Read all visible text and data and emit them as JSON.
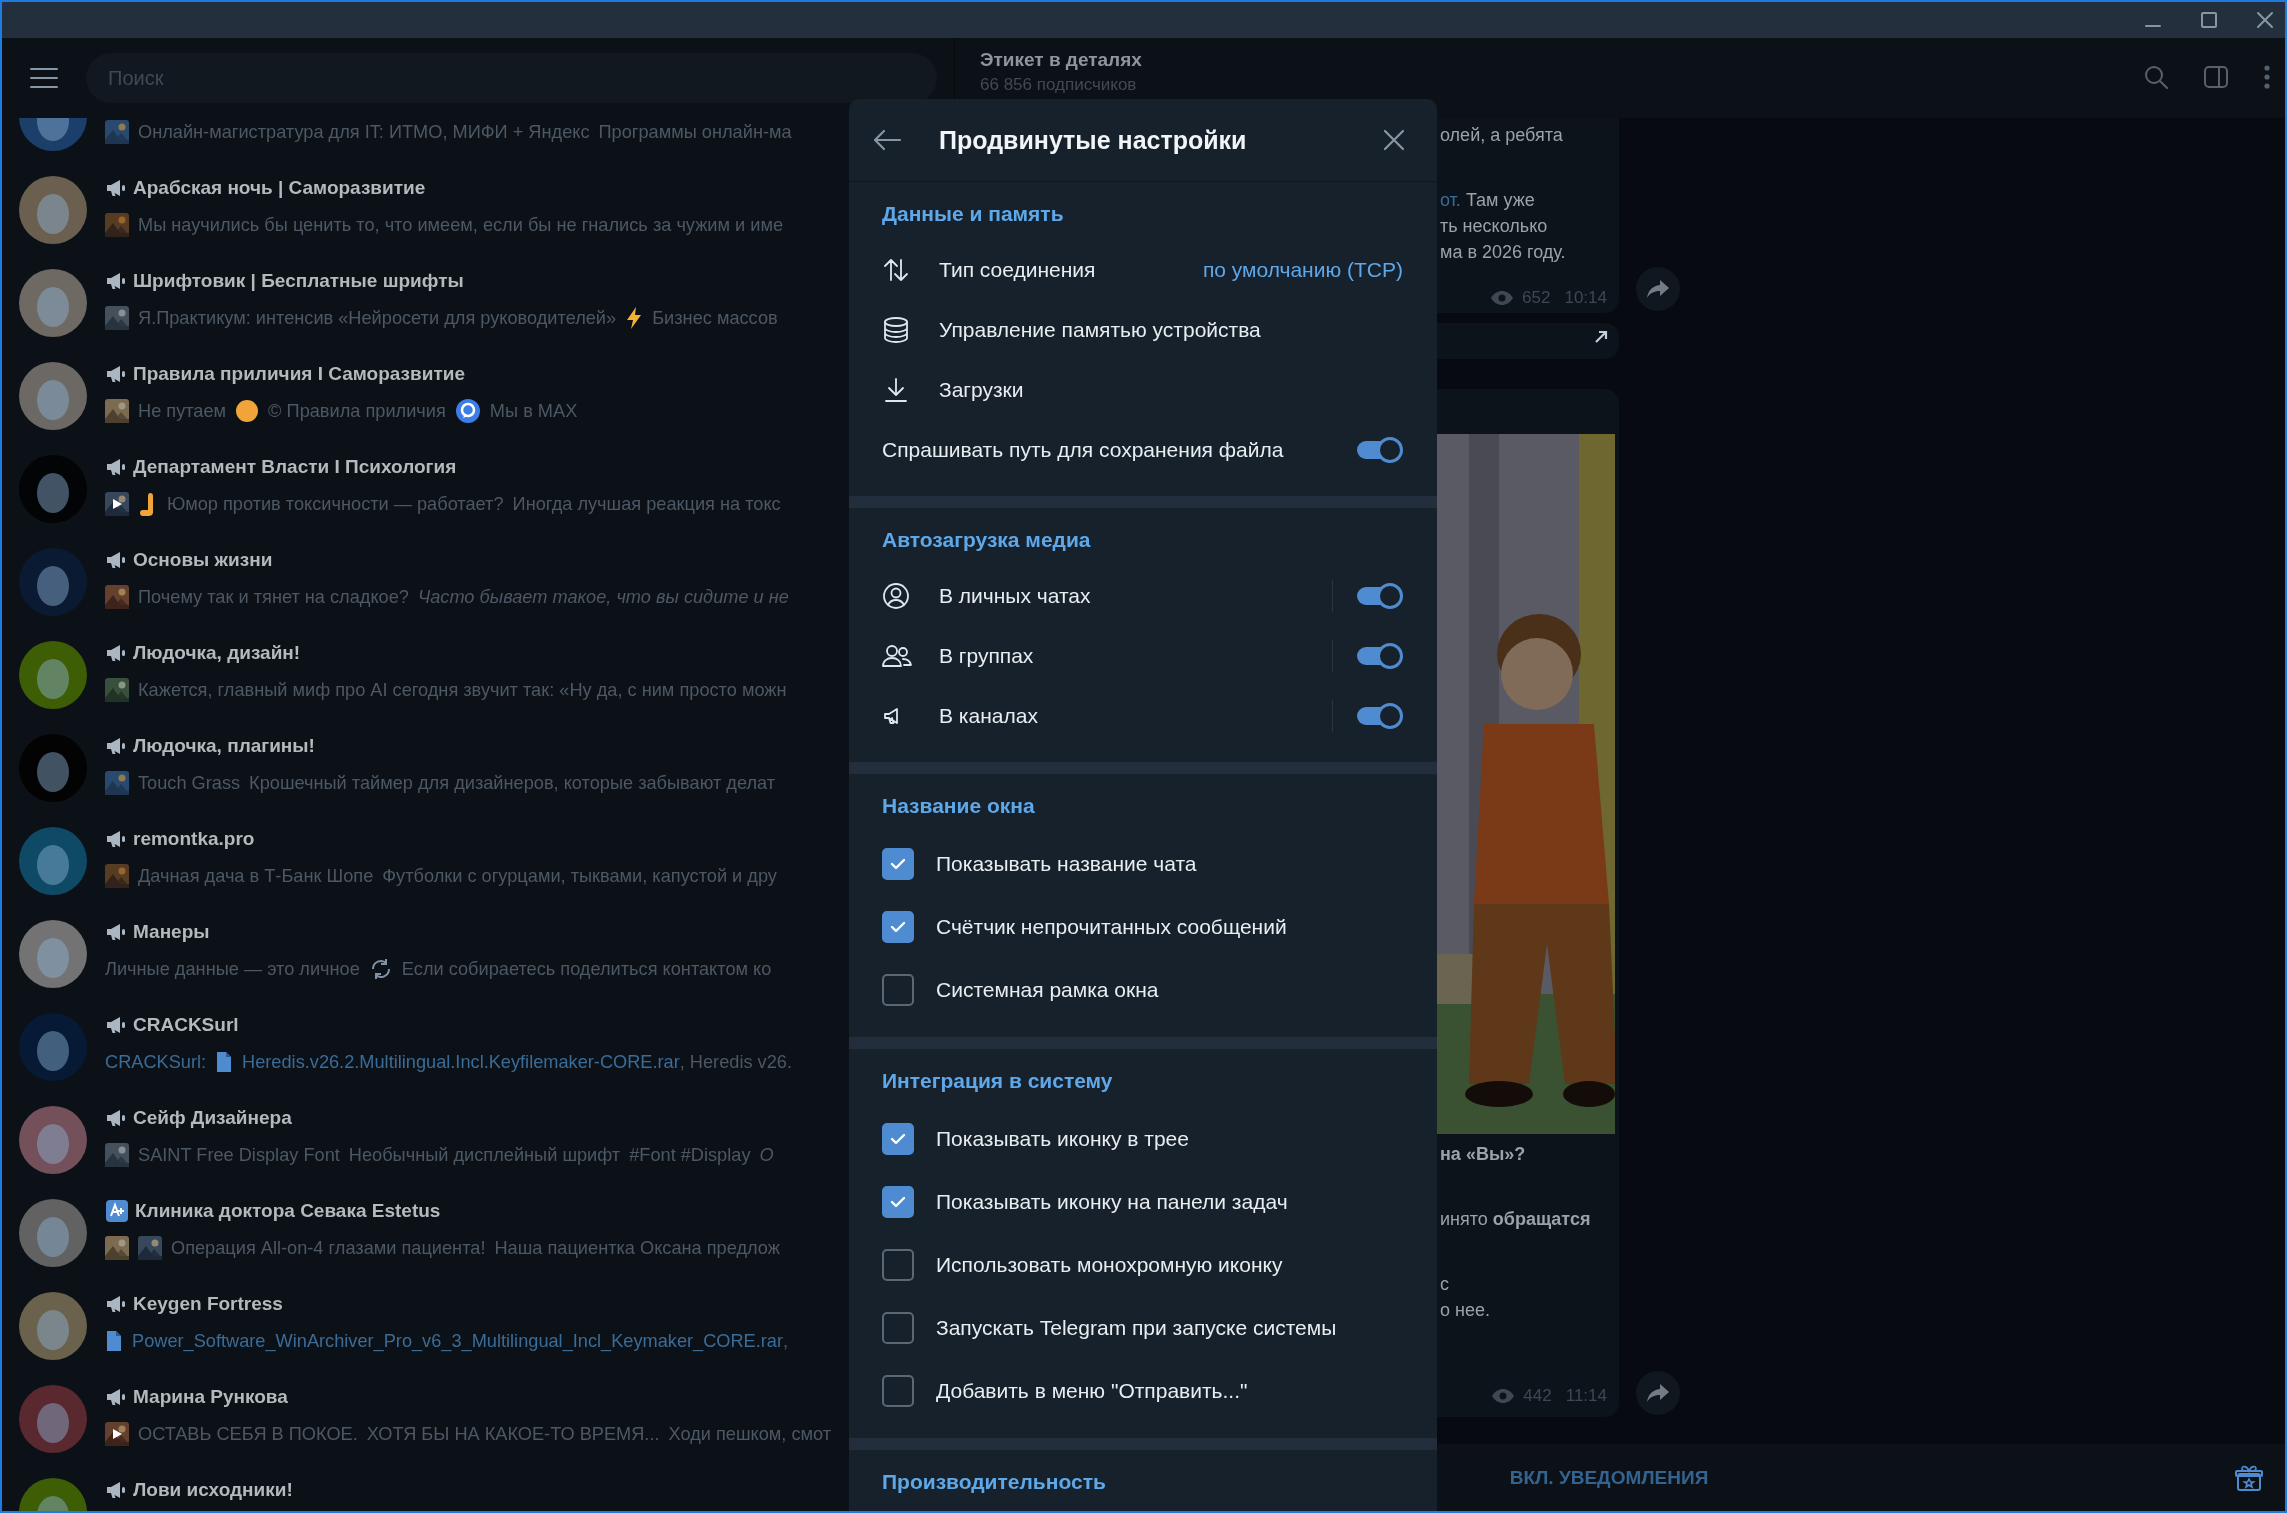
{
  "sidebar": {
    "search": {
      "placeholder": "Поиск"
    },
    "chats": [
      {
        "color": "#1b3f6a",
        "preview": [
          {
            "kind": "thumb"
          },
          {
            "kind": "text",
            "text": "Онлайн-магистратура для IT: ИТМО, МИФИ + Яндекс"
          },
          {
            "kind": "text",
            "text": "Программы онлайн-ма"
          }
        ]
      },
      {
        "name": "Арабская ночь | Саморазвитие",
        "kind": "channel",
        "color": "#6b6050",
        "preview": [
          {
            "kind": "thumb"
          },
          {
            "kind": "text",
            "text": "Мы научились бы ценить то, что имеем, если бы не гнались за чужим и име"
          }
        ]
      },
      {
        "name": "Шрифтовик | Бесплатные шрифты",
        "kind": "channel",
        "color": "#6e6a63",
        "preview": [
          {
            "kind": "thumb"
          },
          {
            "kind": "text",
            "text": "Я.Практикум: интенсив «Нейросети для руководителей»"
          },
          {
            "kind": "bolt"
          },
          {
            "kind": "text",
            "text": "Бизнес массов"
          }
        ]
      },
      {
        "name": "Правила приличия I Саморазвитие",
        "kind": "channel",
        "color": "#6c6964",
        "preview": [
          {
            "kind": "thumb"
          },
          {
            "kind": "text",
            "text": "Не путаем"
          },
          {
            "kind": "emoji"
          },
          {
            "kind": "text",
            "text": "© Правила приличия"
          },
          {
            "kind": "chat-app"
          },
          {
            "kind": "text",
            "text": "Мы в MAX"
          }
        ]
      },
      {
        "name": "Департамент Власти I Психология",
        "kind": "channel",
        "color": "#020406",
        "preview": [
          {
            "kind": "video"
          },
          {
            "kind": "hand"
          },
          {
            "kind": "text",
            "text": "Юмор против токсичности — работает?"
          },
          {
            "kind": "text",
            "text": "Иногда лучшая реакция на токс"
          }
        ]
      },
      {
        "name": "Основы жизни",
        "kind": "channel",
        "color": "#0a1a33",
        "preview": [
          {
            "kind": "thumb"
          },
          {
            "kind": "text",
            "text": "Почему так и тянет на сладкое?"
          },
          {
            "kind": "italic",
            "text": "Часто бывает такое, что вы сидите и не"
          }
        ]
      },
      {
        "name": "Людочка, дизайн!",
        "kind": "channel",
        "color": "#3e5e05",
        "preview": [
          {
            "kind": "thumb"
          },
          {
            "kind": "text",
            "text": "Кажется, главный миф про AI сегодня звучит так: «Ну да, с ним просто можн"
          }
        ]
      },
      {
        "name": "Людочка, плагины!",
        "kind": "channel",
        "color": "#030303",
        "preview": [
          {
            "kind": "thumb"
          },
          {
            "kind": "text",
            "text": "Touch Grass"
          },
          {
            "kind": "text",
            "text": "Крошечный таймер для дизайнеров, которые забывают делат"
          }
        ]
      },
      {
        "name": "remontka.pro",
        "kind": "channel",
        "color": "#0e4a65",
        "preview": [
          {
            "kind": "thumb"
          },
          {
            "kind": "text",
            "text": "Дачная дача в Т-Банк Шопе"
          },
          {
            "kind": "text",
            "text": "Футболки с огурцами, тыквами, капустой и дру"
          }
        ]
      },
      {
        "name": "Манеры",
        "kind": "channel",
        "color": "#737373",
        "preview": [
          {
            "kind": "text",
            "text": "Личные данные — это личное"
          },
          {
            "kind": "cycle"
          },
          {
            "kind": "text",
            "text": "Если собираетесь поделиться контактом ко"
          }
        ]
      },
      {
        "name": "CRACKSurl",
        "kind": "channel",
        "color": "#061a36",
        "preview": [
          {
            "kind": "sender",
            "text": "CRACKSurl:"
          },
          {
            "kind": "file"
          },
          {
            "kind": "link",
            "text": "Heredis.v26.2.Multilingual.Incl.Keyfilemaker-CORE.rar"
          },
          {
            "kind": "tail",
            "text": ", Heredis v26."
          }
        ]
      },
      {
        "name": "Сейф Дизайнера",
        "kind": "channel",
        "color": "#73505a",
        "preview": [
          {
            "kind": "thumb"
          },
          {
            "kind": "text",
            "text": "SAINT Free Display Font"
          },
          {
            "kind": "text",
            "text": "Необычный дисплейный шрифт"
          },
          {
            "kind": "text",
            "text": "#Font #Display"
          },
          {
            "kind": "italic",
            "text": "О"
          }
        ]
      },
      {
        "name": "Клиника доктора Севака Estetus",
        "kind": "promo",
        "color": "#626262",
        "preview": [
          {
            "kind": "thumb"
          },
          {
            "kind": "thumb"
          },
          {
            "kind": "text",
            "text": "Операция All-on-4 глазами пациента!"
          },
          {
            "kind": "text",
            "text": "Наша пациентка Оксана предлож"
          }
        ]
      },
      {
        "name": "Keygen Fortress",
        "kind": "channel",
        "color": "#6b624d",
        "preview": [
          {
            "kind": "file"
          },
          {
            "kind": "link",
            "text": "Power_Software_WinArchiver_Pro_v6_3_Multilingual_Incl_Keymaker_CORE.rar"
          },
          {
            "kind": "tail",
            "text": ","
          }
        ]
      },
      {
        "name": "Марина Рункова",
        "kind": "channel",
        "color": "#5a282f",
        "preview": [
          {
            "kind": "video"
          },
          {
            "kind": "text",
            "text": "ОСТАВЬ СЕБЯ В ПОКОЕ."
          },
          {
            "kind": "text",
            "text": "ХОТЯ БЫ НА КАКОЕ-ТО ВРЕМЯ..."
          },
          {
            "kind": "text",
            "text": "Ходи пешком, смот"
          }
        ]
      },
      {
        "name": "Лови исходники!",
        "kind": "channel",
        "color": "#3e5e05"
      }
    ]
  },
  "chat": {
    "title": "Этикет в деталях",
    "subtitle": "66 856 подписчиков",
    "messages": [
      {
        "kind": "post",
        "lines": [
          {
            "kind": "body",
            "text": "олей, а ребята"
          },
          {
            "kind": "para",
            "link": "от.",
            "text": "Там уже"
          },
          {
            "kind": "body",
            "text": "ть несколько"
          },
          {
            "kind": "body",
            "text": "ма в 2026 году."
          }
        ],
        "views": "652",
        "time": "10:14"
      },
      {
        "kind": "link-preview"
      },
      {
        "kind": "photo-post",
        "lines": [
          {
            "kind": "heading",
            "text": "на «Вы»?"
          },
          {
            "kind": "para",
            "text": "инято **обращатся**"
          },
          {
            "kind": "para",
            "text": "с"
          },
          {
            "kind": "body",
            "text": "о нее."
          }
        ],
        "views": "442",
        "time": "11:14"
      }
    ],
    "notify_button": "ВКЛ. УВЕДОМЛЕНИЯ"
  },
  "dialog": {
    "title": "Продвинутые настройки",
    "sections": [
      {
        "title": "Данные и память",
        "items": [
          {
            "kind": "button",
            "label": "Тип соединения",
            "value": "по умолчанию (TCP)"
          },
          {
            "kind": "button",
            "label": "Управление памятью устройства"
          },
          {
            "kind": "button",
            "label": "Загрузки"
          },
          {
            "kind": "switch",
            "label": "Спрашивать путь для сохранения файла",
            "on": true
          }
        ]
      },
      {
        "title": "Автозагрузка медиа",
        "items": [
          {
            "kind": "switch",
            "label": "В личных чатах",
            "on": true
          },
          {
            "kind": "switch",
            "label": "В группах",
            "on": true
          },
          {
            "kind": "switch",
            "label": "В каналах",
            "on": true
          }
        ]
      },
      {
        "title": "Название окна",
        "items": [
          {
            "kind": "checkbox",
            "label": "Показывать название чата",
            "checked": true
          },
          {
            "kind": "checkbox",
            "label": "Счётчик непрочитанных сообщений",
            "checked": true
          },
          {
            "kind": "checkbox",
            "label": "Системная рамка окна",
            "checked": false
          }
        ]
      },
      {
        "title": "Интеграция в систему",
        "items": [
          {
            "kind": "checkbox",
            "label": "Показывать иконку в трее",
            "checked": true
          },
          {
            "kind": "checkbox",
            "label": "Показывать иконку на панели задач",
            "checked": true
          },
          {
            "kind": "checkbox",
            "label": "Использовать монохромную иконку",
            "checked": false
          },
          {
            "kind": "checkbox",
            "label": "Запускать Telegram при запуске системы",
            "checked": false
          },
          {
            "kind": "checkbox",
            "label": "Добавить в меню \"Отправить...\"",
            "checked": false
          }
        ]
      },
      {
        "title": "Производительность"
      }
    ]
  }
}
